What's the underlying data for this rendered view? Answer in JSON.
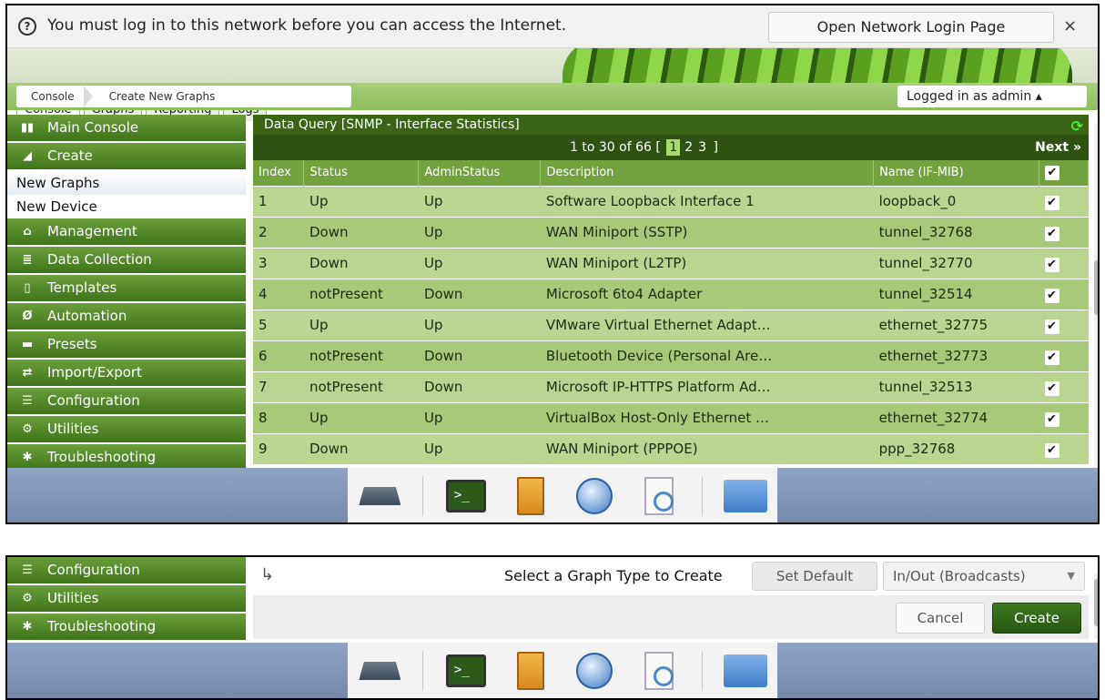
{
  "notification": {
    "message": "You must log in to this network before you can access the Internet.",
    "button": "Open Network Login Page",
    "close": "×",
    "help": "?"
  },
  "tabs": [
    "Console",
    "Graphs",
    "Reporting",
    "Logs"
  ],
  "breadcrumb": [
    "Console",
    "Create New Graphs"
  ],
  "user_menu": "Logged in as admin ▴",
  "sidebar": [
    {
      "label": "Main Console",
      "icon": "map-icon",
      "type": "head"
    },
    {
      "label": "Create",
      "icon": "chart-icon",
      "type": "head"
    },
    {
      "label": "New Graphs",
      "type": "sub",
      "active": true
    },
    {
      "label": "New Device",
      "type": "sub"
    },
    {
      "label": "Management",
      "icon": "home-icon",
      "type": "head"
    },
    {
      "label": "Data Collection",
      "icon": "database-icon",
      "type": "head"
    },
    {
      "label": "Templates",
      "icon": "template-icon",
      "type": "head"
    },
    {
      "label": "Automation",
      "icon": "automation-icon",
      "type": "head"
    },
    {
      "label": "Presets",
      "icon": "preset-icon",
      "type": "head"
    },
    {
      "label": "Import/Export",
      "icon": "exchange-icon",
      "type": "head"
    },
    {
      "label": "Configuration",
      "icon": "sliders-icon",
      "type": "head"
    },
    {
      "label": "Utilities",
      "icon": "gears-icon",
      "type": "head"
    },
    {
      "label": "Troubleshooting",
      "icon": "bug-icon",
      "type": "head"
    }
  ],
  "data_query": {
    "title": "Data Query [SNMP - Interface Statistics]",
    "pager_prefix": "1 to 30 of 66 [",
    "pages": [
      "1",
      "2",
      "3"
    ],
    "current_page": "1",
    "pager_suffix": "]",
    "next": "Next »",
    "columns": [
      "Index",
      "Status",
      "AdminStatus",
      "Description",
      "Name (IF-MIB)",
      "✔"
    ],
    "rows": [
      [
        "1",
        "Up",
        "Up",
        "Software Loopback Interface 1",
        "loopback_0"
      ],
      [
        "2",
        "Down",
        "Up",
        "WAN Miniport (SSTP)",
        "tunnel_32768"
      ],
      [
        "3",
        "Down",
        "Up",
        "WAN Miniport (L2TP)",
        "tunnel_32770"
      ],
      [
        "4",
        "notPresent",
        "Down",
        "Microsoft 6to4 Adapter",
        "tunnel_32514"
      ],
      [
        "5",
        "Up",
        "Up",
        "VMware Virtual Ethernet Adapt…",
        "ethernet_32775"
      ],
      [
        "6",
        "notPresent",
        "Down",
        "Bluetooth Device (Personal Are…",
        "ethernet_32773"
      ],
      [
        "7",
        "notPresent",
        "Down",
        "Microsoft IP-HTTPS Platform Ad…",
        "tunnel_32513"
      ],
      [
        "8",
        "Up",
        "Up",
        "VirtualBox Host-Only Ethernet …",
        "ethernet_32774"
      ],
      [
        "9",
        "Down",
        "Up",
        "WAN Miniport (PPPOE)",
        "ppp_32768"
      ]
    ]
  },
  "sidebar2": [
    {
      "label": "Configuration",
      "icon": "sliders-icon"
    },
    {
      "label": "Utilities",
      "icon": "gears-icon"
    },
    {
      "label": "Troubleshooting",
      "icon": "bug-icon"
    }
  ],
  "graph_type": {
    "arrow": "↳",
    "label": "Select a Graph Type to Create",
    "set_default": "Set Default",
    "selected": "In/Out (Broadcasts)",
    "cancel": "Cancel",
    "create": "Create"
  },
  "dock_icons": [
    "network-icon",
    "terminal-icon",
    "file-cabinet-icon",
    "globe-icon",
    "document-search-icon",
    "folder-icon"
  ],
  "colors": {
    "accent_green": "#3f7418",
    "row_light": "#b9d58f",
    "row_dark": "#a8ca78",
    "taskbar": "#8396b6"
  }
}
